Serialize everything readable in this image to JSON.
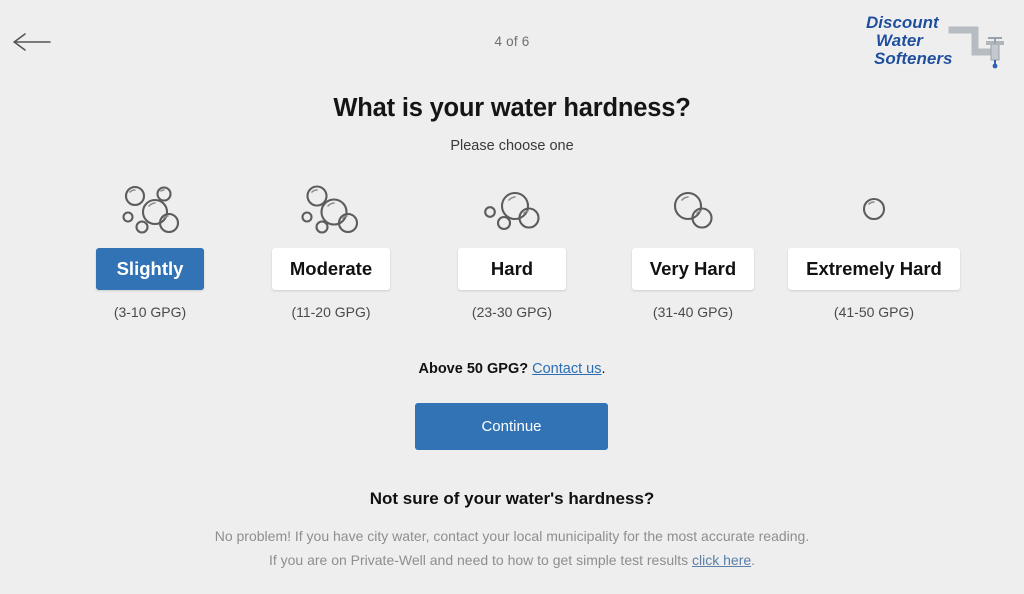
{
  "page": {
    "background_color": "#efeeee",
    "accent_color": "#3173b5"
  },
  "header": {
    "back_icon": "arrow-left-icon",
    "progress": "4 of 6",
    "logo": {
      "line1": "Discount",
      "line2": "Water",
      "line3": "Softeners",
      "color": "#1f4e9c"
    }
  },
  "question": {
    "title": "What is your water hardness?",
    "subtitle": "Please choose one"
  },
  "options": [
    {
      "label": "Slightly",
      "range": "(3-10 GPG)",
      "bubbles": 6,
      "selected": true
    },
    {
      "label": "Moderate",
      "range": "(11-20 GPG)",
      "bubbles": 5,
      "selected": false
    },
    {
      "label": "Hard",
      "range": "(23-30 GPG)",
      "bubbles": 4,
      "selected": false
    },
    {
      "label": "Very Hard",
      "range": "(31-40 GPG)",
      "bubbles": 2,
      "selected": false
    },
    {
      "label": "Extremely Hard",
      "range": "(41-50 GPG)",
      "bubbles": 1,
      "selected": false
    }
  ],
  "contact": {
    "prompt": "Above 50 GPG?",
    "link_label": "Contact us"
  },
  "continue": {
    "label": "Continue"
  },
  "footer": {
    "title": "Not sure of your water's hardness?",
    "line1": "No problem! If you have city water, contact your local municipality for the most accurate reading.",
    "line2_before": "If you are on Private-Well and need to how to get simple test results ",
    "line2_link": "click here",
    "line2_after": "."
  }
}
